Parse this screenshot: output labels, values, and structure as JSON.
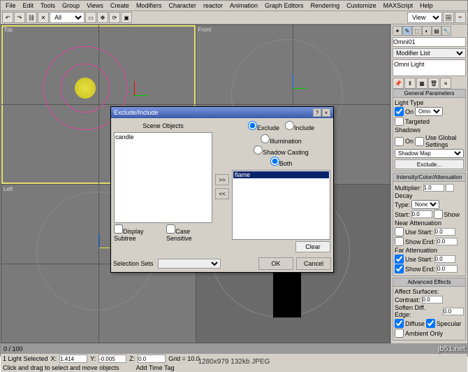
{
  "menu": [
    "File",
    "Edit",
    "Tools",
    "Group",
    "Views",
    "Create",
    "Modifiers",
    "Character",
    "reactor",
    "Animation",
    "Graph Editors",
    "Rendering",
    "Customize",
    "MAXScript",
    "Help"
  ],
  "toolbar": {
    "all": "All",
    "view": "View"
  },
  "viewports": {
    "top": "Top",
    "front": "Front",
    "left": "Left"
  },
  "side": {
    "objName": "Omni01",
    "modList": "Modifier List",
    "stack": "Omni Light",
    "rolls": {
      "gp": "General Parameters",
      "lt_label": "Light Type",
      "lt_on": "On",
      "lt_val": "Omni",
      "lt_targ": "Targeted",
      "sh": "Shadows",
      "sh_on": "On",
      "sh_gl": "Use Global Settings",
      "sh_map": "Shadow Map",
      "sh_ex": "Exclude...",
      "ica": "Intensity/Color/Attenuation",
      "mult": "Multiplier:",
      "mult_v": "1.0",
      "decay": "Decay",
      "d_type": "Type:",
      "d_none": "None",
      "d_start": "Start:",
      "d_sv": "0.0",
      "d_show": "Show",
      "na": "Near Attenuation",
      "na_use": "Use",
      "na_start": "Start:",
      "na_sv": "0.0",
      "na_show": "Show",
      "na_end": "End:",
      "na_ev": "0.0",
      "fa": "Far Attenuation",
      "fa_use": "Use",
      "fa_start": "Start:",
      "fa_sv": "0.0",
      "fa_show": "Show",
      "fa_end": "End:",
      "fa_ev": "0.0",
      "ae": "Advanced Effects",
      "ae_as": "Affect Surfaces:",
      "ae_c": "Contrast:",
      "ae_cv": "0.0",
      "ae_s": "Soften Diff. Edge:",
      "ae_sv": "0.0",
      "ae_dif": "Diffuse",
      "ae_spec": "Specular",
      "ae_amb": "Ambient Only"
    }
  },
  "dialog": {
    "title": "Exclude/Include",
    "sceneObjects": "Scene Objects",
    "exclude": "Exclude",
    "include": "Include",
    "illum": "Illumination",
    "shadcast": "Shadow Casting",
    "both": "Both",
    "leftItems": [
      "candle"
    ],
    "rightItems": [
      "flame"
    ],
    "dispSub": "Display Subtree",
    "caseSens": "Case Sensitive",
    "selSets": "Selection Sets",
    "clear": "Clear",
    "ok": "OK",
    "cancel": "Cancel"
  },
  "timeline": {
    "frame": "0 / 100"
  },
  "status": {
    "sel": "1 Light Selected",
    "hint": "Click and drag to select and move objects",
    "x": "1.414",
    "y": "-0.005",
    "z": "0.0",
    "grid": "Grid = 10.0",
    "addtag": "Add Time Tag"
  },
  "footer": "1280x979  132kb  JPEG",
  "watermark": "jb51.net"
}
